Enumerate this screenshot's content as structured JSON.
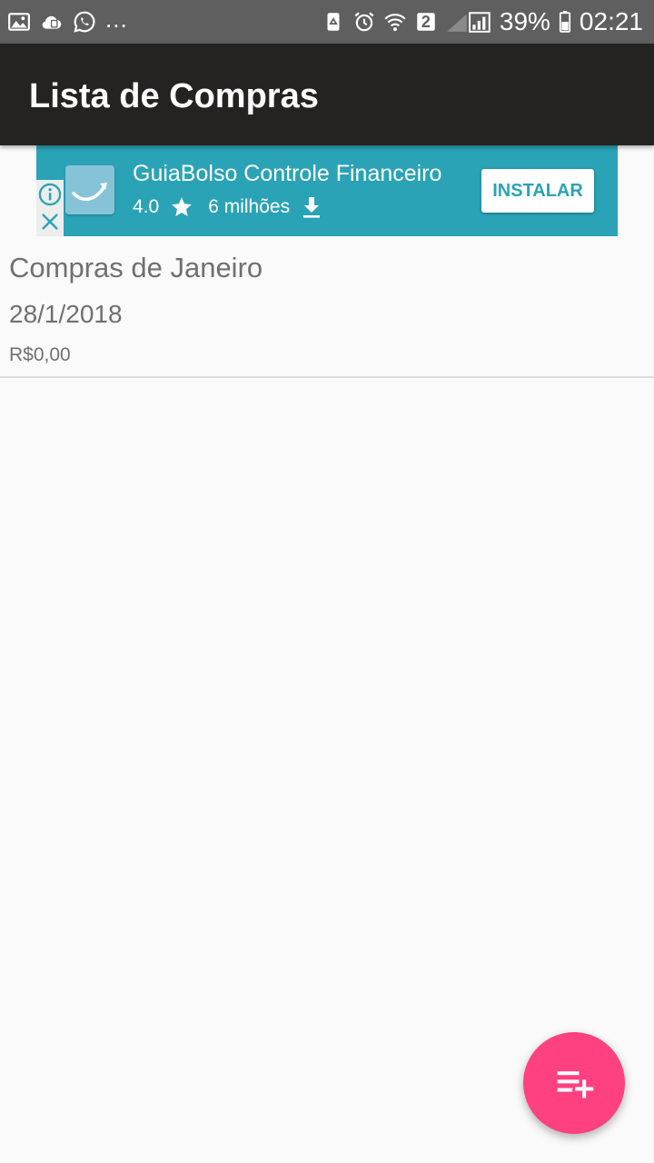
{
  "statusbar": {
    "left_icons": [
      "gallery-icon",
      "cloud-sync-icon",
      "whatsapp-icon"
    ],
    "more": "...",
    "right_icons": [
      "recycle-icon",
      "alarm-icon",
      "wifi-icon",
      "sim2-badge-icon",
      "signal-icon",
      "battery-icon"
    ],
    "sim_badge": "2",
    "battery": "39%",
    "time": "02:21"
  },
  "appbar": {
    "title": "Lista de Compras"
  },
  "ad": {
    "app_name": "GuiaBolso Controle Financeiro",
    "rating": "4.0",
    "downloads": "6 milhões",
    "install_label": "INSTALAR",
    "icons": [
      "info-icon",
      "close-icon",
      "app-logo-icon",
      "star-icon",
      "download-icon"
    ]
  },
  "lists": [
    {
      "name": "Compras de Janeiro",
      "date": "28/1/2018",
      "total": "R$0,00"
    }
  ],
  "fab": {
    "icon": "add-list-icon"
  },
  "colors": {
    "statusbar": "#5f5f5f",
    "appbar": "#252222",
    "ad_background": "#2aa3b6",
    "fab": "#ff4081",
    "list_text": "#707070",
    "page_background": "#fafafa"
  }
}
